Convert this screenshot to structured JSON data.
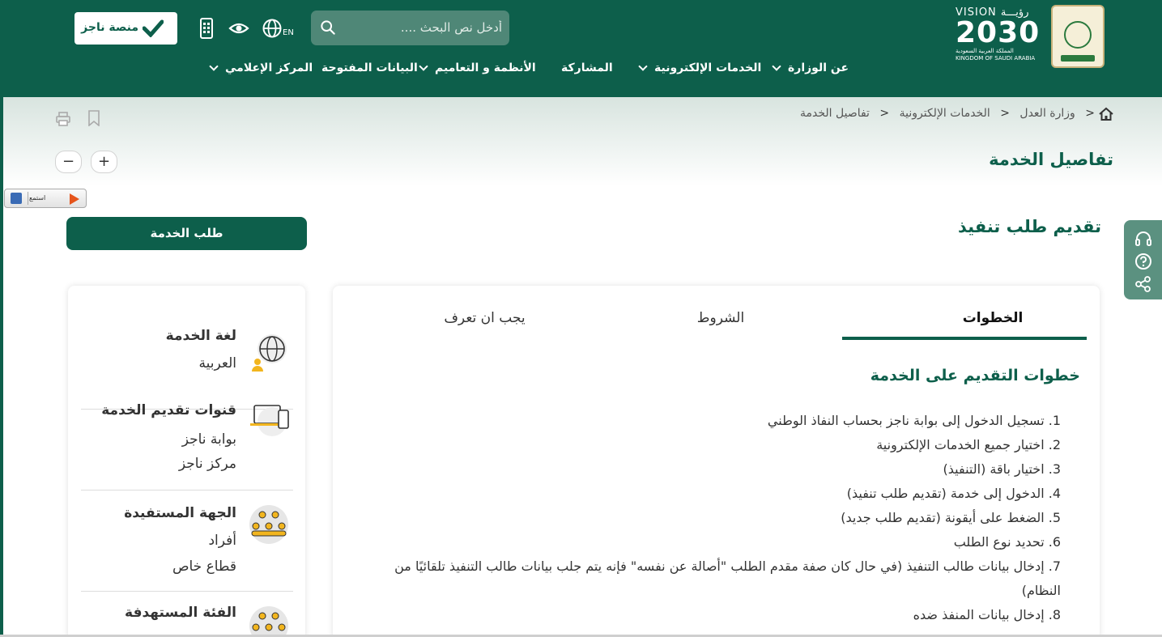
{
  "header": {
    "vision": {
      "line1": "VISION رؤيـــة",
      "line2": "2030",
      "line3": "المملكة العربية السعودية",
      "line4": "KINGDOM OF SAUDI ARABIA"
    },
    "search": {
      "placeholder": "أدخل نص البحث ...."
    },
    "lang_label": "EN",
    "najiz": {
      "label": "منصة ناجز"
    },
    "nav": [
      {
        "label": "عن الوزارة",
        "has_dropdown": true
      },
      {
        "label": "الخدمات الإلكترونية",
        "has_dropdown": true
      },
      {
        "label": "المشاركة",
        "has_dropdown": false
      },
      {
        "label": "الأنظمة و التعاميم",
        "has_dropdown": true
      },
      {
        "label": "البيانات المفتوحة",
        "has_dropdown": false
      },
      {
        "label": "المركز الإعلامي",
        "has_dropdown": true
      }
    ]
  },
  "breadcrumb": [
    "وزارة العدل",
    "الخدمات الإلكترونية",
    "تفاصيل الخدمة"
  ],
  "zoom": {
    "plus": "+",
    "minus": "−"
  },
  "page_title": "تفاصيل الخدمة",
  "listen": {
    "label": "استمع"
  },
  "service": {
    "title": "تقديم طلب تنفيذ",
    "request_button": "طلب الخدمة"
  },
  "tabs": [
    {
      "label": "الخطوات",
      "active": true
    },
    {
      "label": "الشروط",
      "active": false
    },
    {
      "label": "يجب ان تعرف",
      "active": false
    }
  ],
  "steps_heading": "خطوات التقديم على الخدمة",
  "steps": [
    "1. تسجيل الدخول إلى بوابة ناجز بحساب النفاذ الوطني",
    "2. اختيار جميع الخدمات الإلكترونية",
    "3. اختيار باقة (التنفيذ)",
    "4. الدخول إلى خدمة (تقديم طلب تنفيذ)",
    "5. الضغط على أيقونة (تقديم طلب جديد)",
    "6. تحديد نوع الطلب",
    "7. إدخال بيانات طالب التنفيذ (في حال كان صفة مقدم الطلب \"أصالة عن نفسه\" فإنه يتم جلب بيانات طالب التنفيذ تلقائيًا من النظام)",
    "8. إدخال بيانات المنفذ ضده"
  ],
  "side": {
    "language": {
      "label": "لغة الخدمة",
      "values": [
        "العربية"
      ]
    },
    "channels": {
      "label": "قنوات تقديم الخدمة",
      "values": [
        "بوابة ناجز",
        "مركز ناجز"
      ]
    },
    "beneficiary": {
      "label": "الجهة المستفيدة",
      "values": [
        "أفراد",
        "قطاع خاص"
      ]
    },
    "target": {
      "label": "الفئة المستهدفة",
      "values": []
    }
  }
}
